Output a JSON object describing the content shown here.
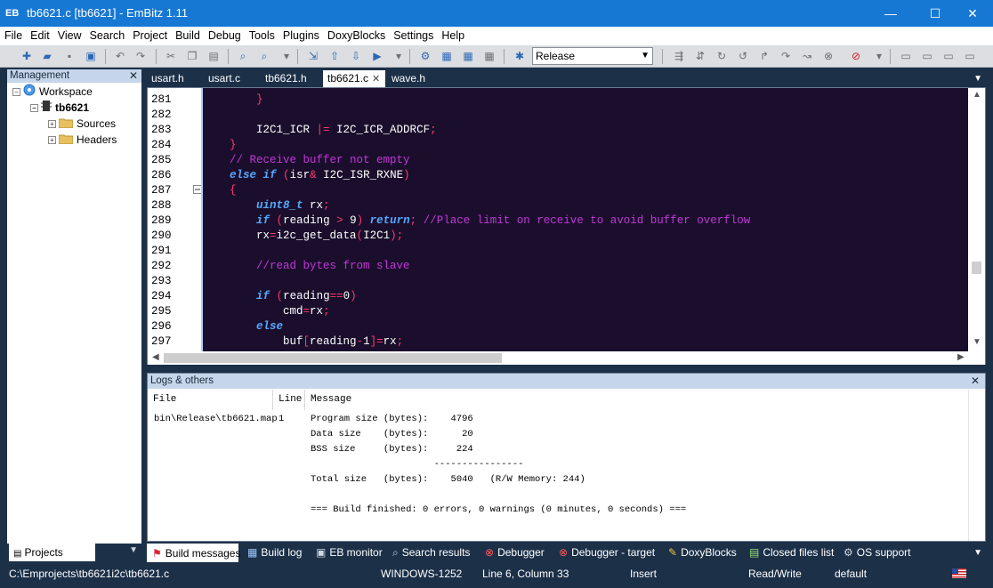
{
  "window": {
    "title": "tb6621.c [tb6621] - EmBitz 1.11",
    "minimize": "—",
    "maximize": "☐",
    "close": "✕"
  },
  "menu": [
    "File",
    "Edit",
    "View",
    "Search",
    "Project",
    "Build",
    "Debug",
    "Tools",
    "Plugins",
    "DoxyBlocks",
    "Settings",
    "Help"
  ],
  "toolbar": {
    "build_target": "Release"
  },
  "management": {
    "title": "Management",
    "workspace": "Workspace",
    "project": "tb6621",
    "folders": [
      "Sources",
      "Headers"
    ],
    "footer_tab": "Projects"
  },
  "file_tabs": [
    "usart.h",
    "usart.c",
    "tb6621.h",
    "tb6621.c",
    "wave.h"
  ],
  "active_file_tab": 3,
  "editor": {
    "line_numbers": [
      "281",
      "282",
      "283",
      "284",
      "285",
      "286",
      "287",
      "288",
      "289",
      "290",
      "291",
      "292",
      "293",
      "294",
      "295",
      "296",
      "297"
    ]
  },
  "logs": {
    "title": "Logs & others",
    "columns": [
      "File",
      "Line",
      "Message"
    ],
    "file": "bin\\Release\\tb6621.map",
    "line": "1",
    "messages": [
      "Program size (bytes):    4796",
      "Data size    (bytes):      20",
      "BSS size     (bytes):     224",
      "                      ----------------",
      "Total size   (bytes):    5040   (R/W Memory: 244)",
      "",
      "=== Build finished: 0 errors, 0 warnings (0 minutes, 0 seconds) ==="
    ]
  },
  "bottom_tabs": [
    "Build messages",
    "Build log",
    "EB monitor",
    "Search results",
    "Debugger",
    "Debugger - target",
    "DoxyBlocks",
    "Closed files list",
    "OS support"
  ],
  "status": {
    "path": "C:\\Emprojects\\tb6621i2c\\tb6621.c",
    "encoding": "WINDOWS-1252",
    "position": "Line 6, Column 33",
    "mode": "Insert",
    "access": "Read/Write",
    "profile": "default"
  },
  "colors": {
    "titlebar": "#1778d4",
    "panel_bg": "#1c3048",
    "editor_bg": "#1a0e2c",
    "keyword": "#56a8ff",
    "operator": "#ff3a6e",
    "comment": "#c437d8"
  }
}
